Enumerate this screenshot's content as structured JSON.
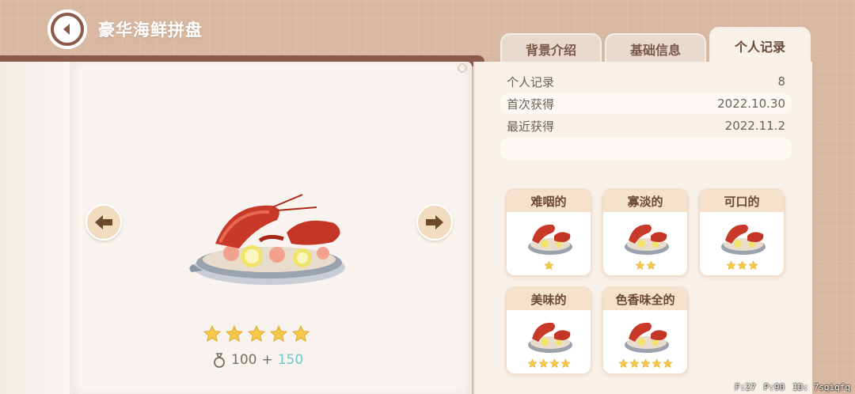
{
  "header": {
    "title": "豪华海鲜拼盘",
    "back_icon": "chevron-left-icon"
  },
  "tabs": [
    {
      "label": "背景介绍",
      "active": false
    },
    {
      "label": "基础信息",
      "active": false
    },
    {
      "label": "个人记录",
      "active": true
    }
  ],
  "record": {
    "rows": [
      {
        "label": "个人记录",
        "value": "8"
      },
      {
        "label": "首次获得",
        "value": "2022.10.30"
      },
      {
        "label": "最近获得",
        "value": "2022.11.2"
      }
    ]
  },
  "dish": {
    "star_rating": 5,
    "price_base": "100",
    "price_plus": "+",
    "price_bonus": "150",
    "money_icon": "coin-bag-icon"
  },
  "quality_cards": [
    {
      "label": "难咽的",
      "stars": 1
    },
    {
      "label": "寡淡的",
      "stars": 2
    },
    {
      "label": "可口的",
      "stars": 3
    },
    {
      "label": "美味的",
      "stars": 4
    },
    {
      "label": "色香味全的",
      "stars": 5
    }
  ],
  "debug": {
    "f": "F:27",
    "p": "P:90",
    "id": "ID: 7sqiqfq"
  },
  "colors": {
    "star": "#f7c948",
    "bonus": "#6ac8d0",
    "tab_text": "#7a5848"
  }
}
